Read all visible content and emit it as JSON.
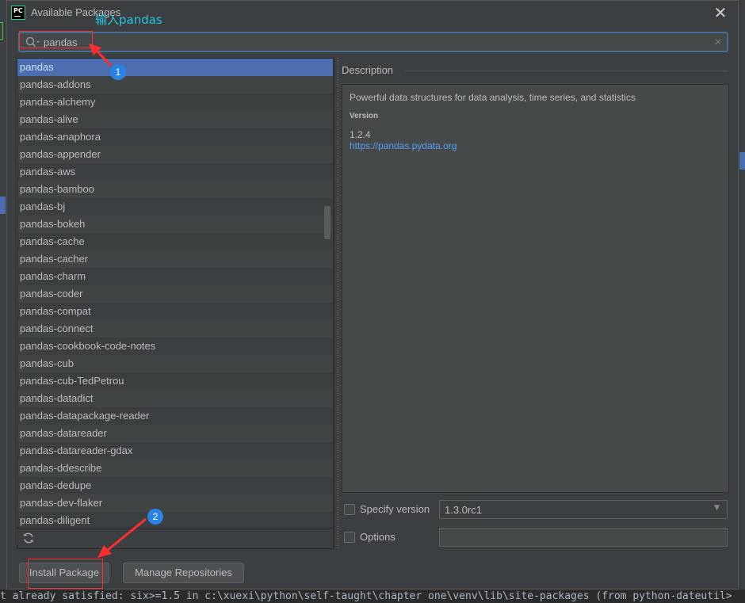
{
  "dialog": {
    "title": "Available Packages",
    "close_glyph": "✕",
    "app_icon_text": "PC"
  },
  "search": {
    "value": "pandas",
    "clear_glyph": "✕"
  },
  "packages": [
    "pandas",
    "pandas-addons",
    "pandas-alchemy",
    "pandas-alive",
    "pandas-anaphora",
    "pandas-appender",
    "pandas-aws",
    "pandas-bamboo",
    "pandas-bj",
    "pandas-bokeh",
    "pandas-cache",
    "pandas-cacher",
    "pandas-charm",
    "pandas-coder",
    "pandas-compat",
    "pandas-connect",
    "pandas-cookbook-code-notes",
    "pandas-cub",
    "pandas-cub-TedPetrou",
    "pandas-datadict",
    "pandas-datapackage-reader",
    "pandas-datareader",
    "pandas-datareader-gdax",
    "pandas-ddescribe",
    "pandas-dedupe",
    "pandas-dev-flaker",
    "pandas-diligent"
  ],
  "selected_package": "pandas",
  "description": {
    "heading": "Description",
    "summary": "Powerful data structures for data analysis, time series, and statistics",
    "version_label": "Version",
    "version": "1.2.4",
    "link": "https://pandas.pydata.org"
  },
  "options": {
    "specify_version_label": "Specify version",
    "specify_version_checked": false,
    "version_value": "1.3.0rc1",
    "options_label": "Options",
    "options_checked": false,
    "options_value": ""
  },
  "buttons": {
    "install": "Install Package",
    "manage": "Manage Repositories"
  },
  "annotations": {
    "hint_text": "输入pandas",
    "badge1": "1",
    "badge2": "2",
    "color_red": "#ff2d2d",
    "color_badge": "#2a82e4"
  },
  "console": {
    "text": "t already satisfied: six>=1.5 in c:\\xuexi\\python\\self-taught\\chapter one\\venv\\lib\\site-packages (from python-dateutil>"
  },
  "colors": {
    "selection": "#4b6eaf",
    "link": "#589df6",
    "dialog_bg": "#3c3f41"
  },
  "icons": {
    "search": "search-icon",
    "refresh": "refresh-icon",
    "close": "close-icon",
    "dropdown": "chevron-down-icon"
  }
}
